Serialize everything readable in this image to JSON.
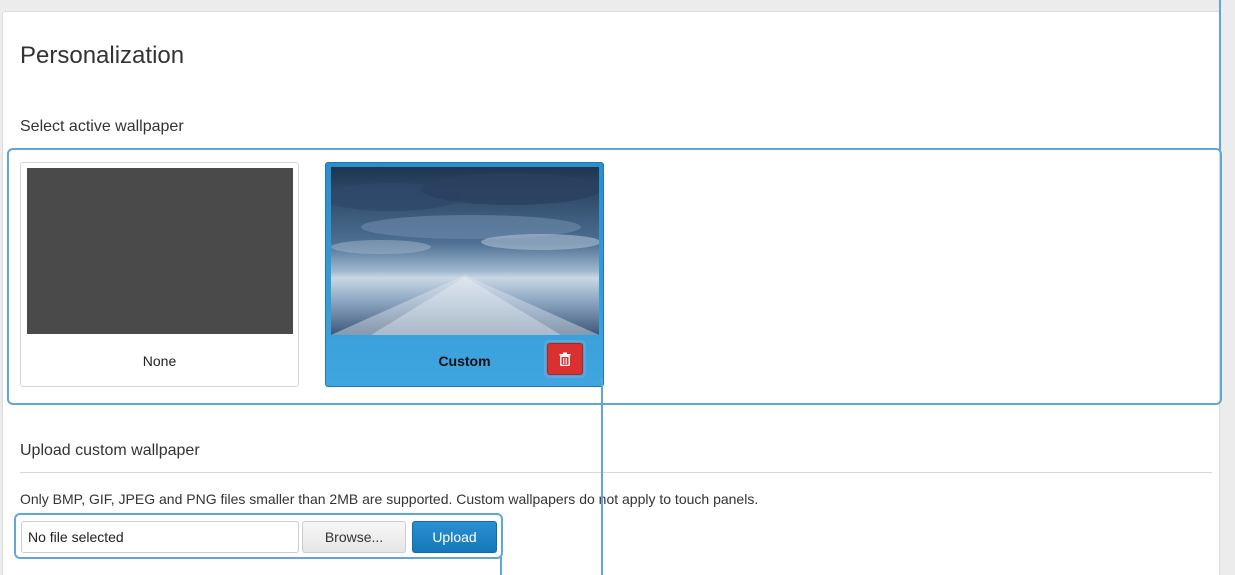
{
  "page": {
    "title": "Personalization"
  },
  "wallpaper": {
    "section_title": "Select active wallpaper",
    "tiles": [
      {
        "label": "None",
        "selected": false
      },
      {
        "label": "Custom",
        "selected": true
      }
    ],
    "delete_icon": "trash-icon"
  },
  "upload": {
    "section_title": "Upload custom wallpaper",
    "info": "Only BMP, GIF, JPEG and PNG files smaller than 2MB are supported. Custom wallpapers do not apply to touch panels.",
    "file_value": "No file selected",
    "browse_label": "Browse...",
    "upload_label": "Upload"
  },
  "colors": {
    "selected_tile": "#2a8fcd",
    "delete_button": "#d93030",
    "upload_button": "#1578bb",
    "highlight": "#5ea7d6"
  }
}
